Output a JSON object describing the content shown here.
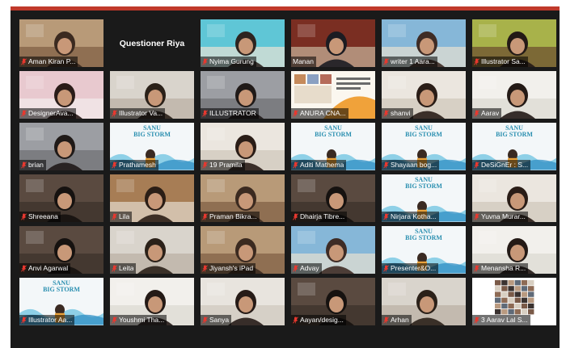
{
  "colors": {
    "accent_bar": "#c0392b",
    "grid_background": "#1a1a1a",
    "muted_mic": "#e8382f",
    "cover_title": "#2a8fb0"
  },
  "cover_title_lines": [
    "SANU",
    "BIG STORM"
  ],
  "center_text_tiles": {
    "questioner": "Questioner Riya"
  },
  "participants": [
    {
      "name": "Aman Kiran P...",
      "scene": "room-warm",
      "muted": true
    },
    {
      "name": "",
      "scene": "text",
      "muted": false
    },
    {
      "name": "Nyima Gurung",
      "scene": "room-cyan",
      "muted": true
    },
    {
      "name": "Manan",
      "scene": "room-red",
      "muted": false
    },
    {
      "name": "writer 1 Aara...",
      "scene": "room-blue",
      "muted": true
    },
    {
      "name": "Illustrator Sa...",
      "scene": "room-olive",
      "muted": true
    },
    {
      "name": "DesignerAva...",
      "scene": "room-pink",
      "muted": true
    },
    {
      "name": "Illustrator Va...",
      "scene": "room-plain",
      "muted": true
    },
    {
      "name": "ILLUSTRATOR",
      "scene": "room-grey",
      "muted": true
    },
    {
      "name": "ANURA CNA...",
      "scene": "poster",
      "muted": true
    },
    {
      "name": "shanvi",
      "scene": "room-light",
      "muted": true
    },
    {
      "name": "Aarav",
      "scene": "room-white",
      "muted": true
    },
    {
      "name": "brian",
      "scene": "room-grey",
      "muted": true
    },
    {
      "name": "Prathamesh",
      "scene": "cover",
      "muted": true
    },
    {
      "name": "19 Pramila",
      "scene": "room-light",
      "muted": true
    },
    {
      "name": "Aditi Mathema",
      "scene": "cover",
      "muted": true
    },
    {
      "name": "Shayaan bog...",
      "scene": "cover",
      "muted": true
    },
    {
      "name": "DeSiGnEr : S...",
      "scene": "cover",
      "muted": true
    },
    {
      "name": "Shreeana",
      "scene": "room-dark",
      "muted": true
    },
    {
      "name": "Lila",
      "scene": "room-shelf",
      "muted": true
    },
    {
      "name": "Praman Bikra...",
      "scene": "room-warm",
      "muted": true
    },
    {
      "name": "Dhairja Tibre...",
      "scene": "room-dark",
      "muted": true
    },
    {
      "name": "Nirjara Kotha...",
      "scene": "cover",
      "muted": true
    },
    {
      "name": "Yuvna Murar...",
      "scene": "room-light",
      "muted": true
    },
    {
      "name": "Anvi Agarwal",
      "scene": "room-dark",
      "muted": true
    },
    {
      "name": "Leita",
      "scene": "room-plain",
      "muted": true
    },
    {
      "name": "Jiyansh's iPad",
      "scene": "room-warm",
      "muted": true
    },
    {
      "name": "Advay",
      "scene": "room-blue",
      "muted": true
    },
    {
      "name": "Presenter&O...",
      "scene": "cover",
      "muted": true
    },
    {
      "name": "Menansha R...",
      "scene": "room-white",
      "muted": true
    },
    {
      "name": "Illustrator Aa...",
      "scene": "cover",
      "muted": true
    },
    {
      "name": "Youshmi Tha...",
      "scene": "room-white",
      "muted": true
    },
    {
      "name": "Sanya",
      "scene": "room-narrow",
      "muted": true
    },
    {
      "name": "Aayan/desig...",
      "scene": "room-dark",
      "muted": true
    },
    {
      "name": "Arhan",
      "scene": "room-plain",
      "muted": true
    },
    {
      "name": "3 Aarav Lal S...",
      "scene": "gallery",
      "muted": true
    }
  ]
}
